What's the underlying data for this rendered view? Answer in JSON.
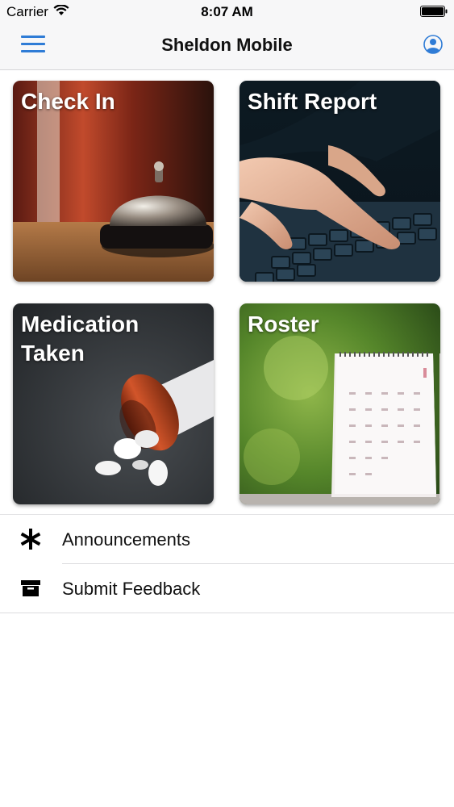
{
  "status_bar": {
    "carrier": "Carrier",
    "time": "8:07 AM"
  },
  "nav": {
    "title": "Sheldon Mobile",
    "menu_icon": "hamburger-menu-icon",
    "profile_icon": "user-profile-icon",
    "accent": "#2f7cd6"
  },
  "tiles": [
    {
      "title": "Check In",
      "image": "service-bell-photo"
    },
    {
      "title": "Shift Report",
      "image": "typing-keyboard-photo"
    },
    {
      "title": "Medication\nTaken",
      "image": "spilled-pills-photo"
    },
    {
      "title": "Roster",
      "image": "desk-calendar-photo"
    }
  ],
  "list": [
    {
      "label": "Announcements",
      "icon": "asterisk-icon"
    },
    {
      "label": "Submit Feedback",
      "icon": "archive-box-icon"
    }
  ]
}
